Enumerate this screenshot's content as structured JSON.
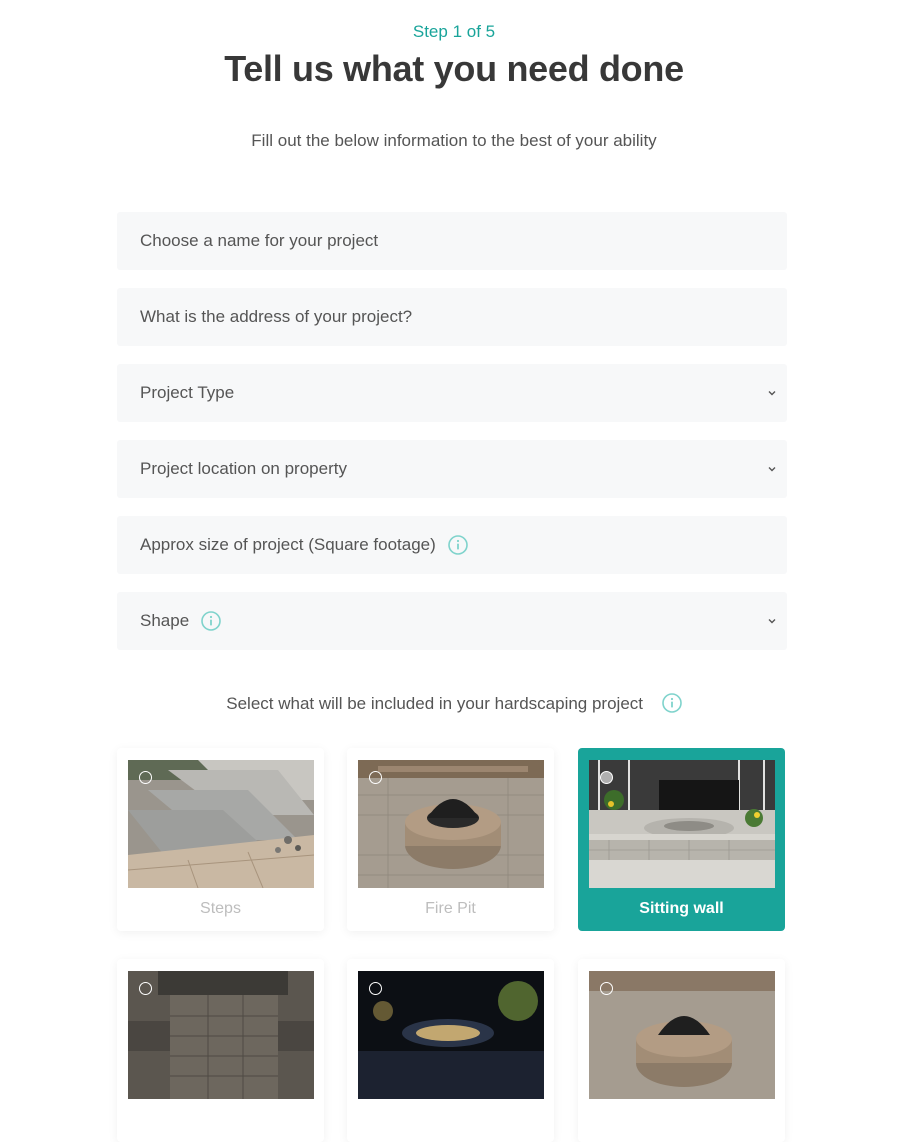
{
  "header": {
    "step": "Step 1 of 5",
    "title": "Tell us what you need done",
    "subtitle": "Fill out the below information to the best of your ability"
  },
  "form": {
    "project_name_placeholder": "Choose a name for your project",
    "address_placeholder": "What is the address of your project?",
    "project_type_label": "Project Type",
    "project_location_label": "Project location on property",
    "approx_size_placeholder": "Approx size of project (Square footage)",
    "shape_label": "Shape"
  },
  "includes": {
    "label": "Select what will be included in your hardscaping project",
    "options": [
      {
        "label": "Steps",
        "selected": false
      },
      {
        "label": "Fire Pit",
        "selected": false
      },
      {
        "label": "Sitting wall",
        "selected": true
      },
      {
        "label": "",
        "selected": false
      },
      {
        "label": "",
        "selected": false
      },
      {
        "label": "",
        "selected": false
      }
    ]
  },
  "colors": {
    "accent": "#19a49a",
    "field_bg": "#f7f8f9",
    "title": "#383838"
  },
  "icons": {
    "info": "info-circle-icon",
    "dropdown": "chevron-down-icon",
    "radio": "radio-circle-icon"
  }
}
